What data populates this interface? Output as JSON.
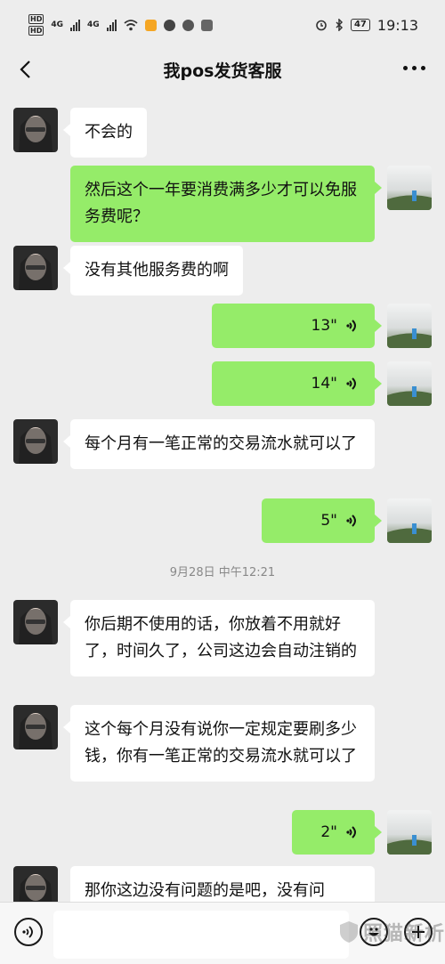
{
  "status_bar": {
    "hd1": "HD",
    "hd2": "HD",
    "net1": "4G",
    "net2": "4G",
    "battery": "47",
    "time": "19:13"
  },
  "header": {
    "title": "我pos发货客服"
  },
  "messages": {
    "m1": "不会的",
    "m2": "然后这个一年要消费满多少才可以免服务费呢？",
    "m3": "没有其他服务费的啊",
    "v1": "13\"",
    "v2": "14\"",
    "m4": "每个月有一笔正常的交易流水就可以了",
    "v3": "5\"",
    "timestamp": "9月28日 中午12:21",
    "m5": "你后期不使用的话，你放着不用就好了，时间久了，公司这边会自动注销的",
    "m6": "这个每个月没有说你一定规定要刷多少钱，你有一笔正常的交易流水就可以了",
    "v4": "2\"",
    "m7": "那你这边没有问题的是吧，没有问"
  },
  "input": {
    "placeholder": ""
  },
  "watermark": {
    "text": "照猫新析"
  },
  "icons": {
    "back": "back-arrow-icon",
    "more": "more-dots-icon",
    "voice": "voice-wave-icon",
    "emoji": "emoji-icon",
    "plus": "plus-icon"
  },
  "colors": {
    "outgoing_bubble": "#95ec69",
    "incoming_bubble": "#ffffff",
    "background": "#ededed"
  }
}
